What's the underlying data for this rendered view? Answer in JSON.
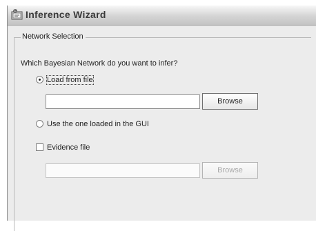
{
  "window": {
    "title": "Inference Wizard",
    "icon": "wizard-app-icon"
  },
  "network_selection": {
    "group_title": "Network Selection",
    "question": "Which Bayesian Network do you want to infer?",
    "load_from_file": {
      "label": "Load from file",
      "selected": true
    },
    "file_path": {
      "value": "",
      "placeholder": ""
    },
    "browse_label": "Browse",
    "use_gui": {
      "label": "Use the one loaded in the GUI",
      "selected": false
    },
    "evidence": {
      "label": "Evidence file",
      "checked": false
    },
    "evidence_path": {
      "value": "",
      "placeholder": ""
    },
    "evidence_browse_label": "Browse"
  }
}
